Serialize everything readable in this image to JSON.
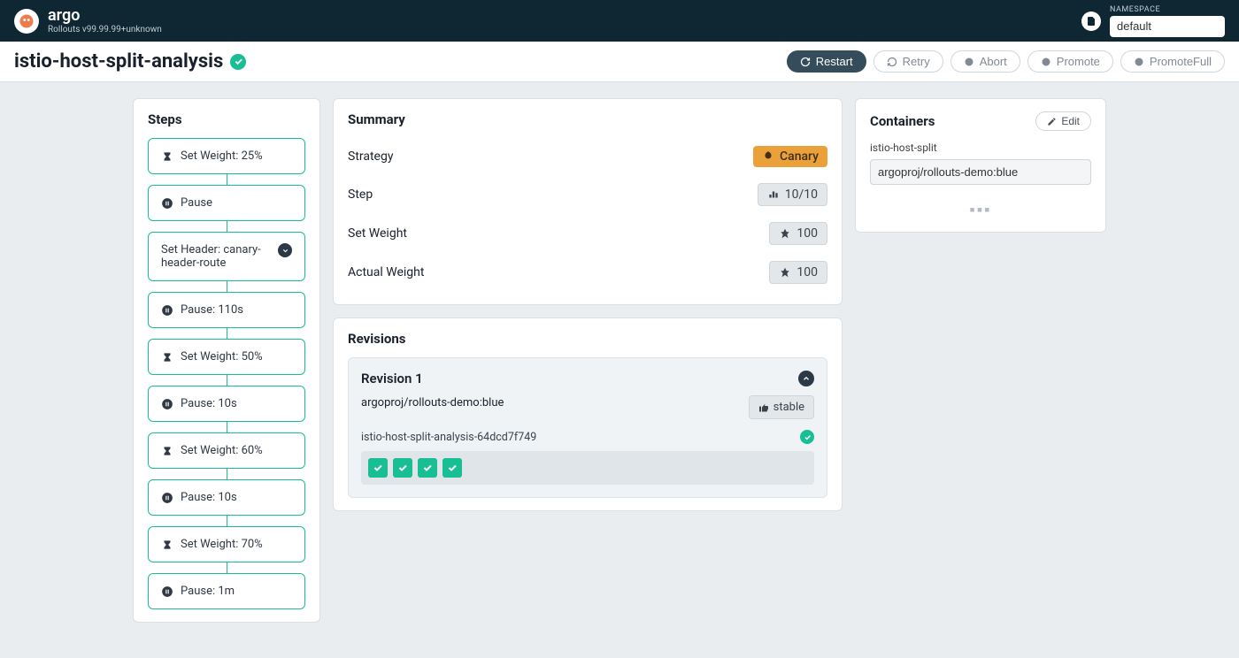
{
  "brand": {
    "name": "argo",
    "version": "Rollouts v99.99.99+unknown"
  },
  "namespace": {
    "label": "NAMESPACE",
    "value": "default"
  },
  "header": {
    "title": "istio-host-split-analysis"
  },
  "actions": {
    "restart": "Restart",
    "retry": "Retry",
    "abort": "Abort",
    "promote": "Promote",
    "promoteFull": "PromoteFull"
  },
  "steps": {
    "title": "Steps",
    "items": [
      {
        "kind": "weight",
        "label": "Set Weight: 25%"
      },
      {
        "kind": "pause",
        "label": "Pause"
      },
      {
        "kind": "header",
        "label": "Set Header: canary-header-route"
      },
      {
        "kind": "pause",
        "label": "Pause: 110s"
      },
      {
        "kind": "weight",
        "label": "Set Weight: 50%"
      },
      {
        "kind": "pause",
        "label": "Pause: 10s"
      },
      {
        "kind": "weight",
        "label": "Set Weight: 60%"
      },
      {
        "kind": "pause",
        "label": "Pause: 10s"
      },
      {
        "kind": "weight",
        "label": "Set Weight: 70%"
      },
      {
        "kind": "pause",
        "label": "Pause: 1m"
      }
    ]
  },
  "summary": {
    "title": "Summary",
    "rows": {
      "strategy_label": "Strategy",
      "strategy_value": "Canary",
      "step_label": "Step",
      "step_value": "10/10",
      "setweight_label": "Set Weight",
      "setweight_value": "100",
      "actualweight_label": "Actual Weight",
      "actualweight_value": "100"
    }
  },
  "containers": {
    "title": "Containers",
    "edit": "Edit",
    "name": "istio-host-split",
    "image": "argoproj/rollouts-demo:blue"
  },
  "revisions": {
    "title": "Revisions",
    "items": [
      {
        "title": "Revision 1",
        "image": "argoproj/rollouts-demo:blue",
        "badge": "stable",
        "rs": "istio-host-split-analysis-64dcd7f749",
        "pods": 4
      }
    ]
  }
}
